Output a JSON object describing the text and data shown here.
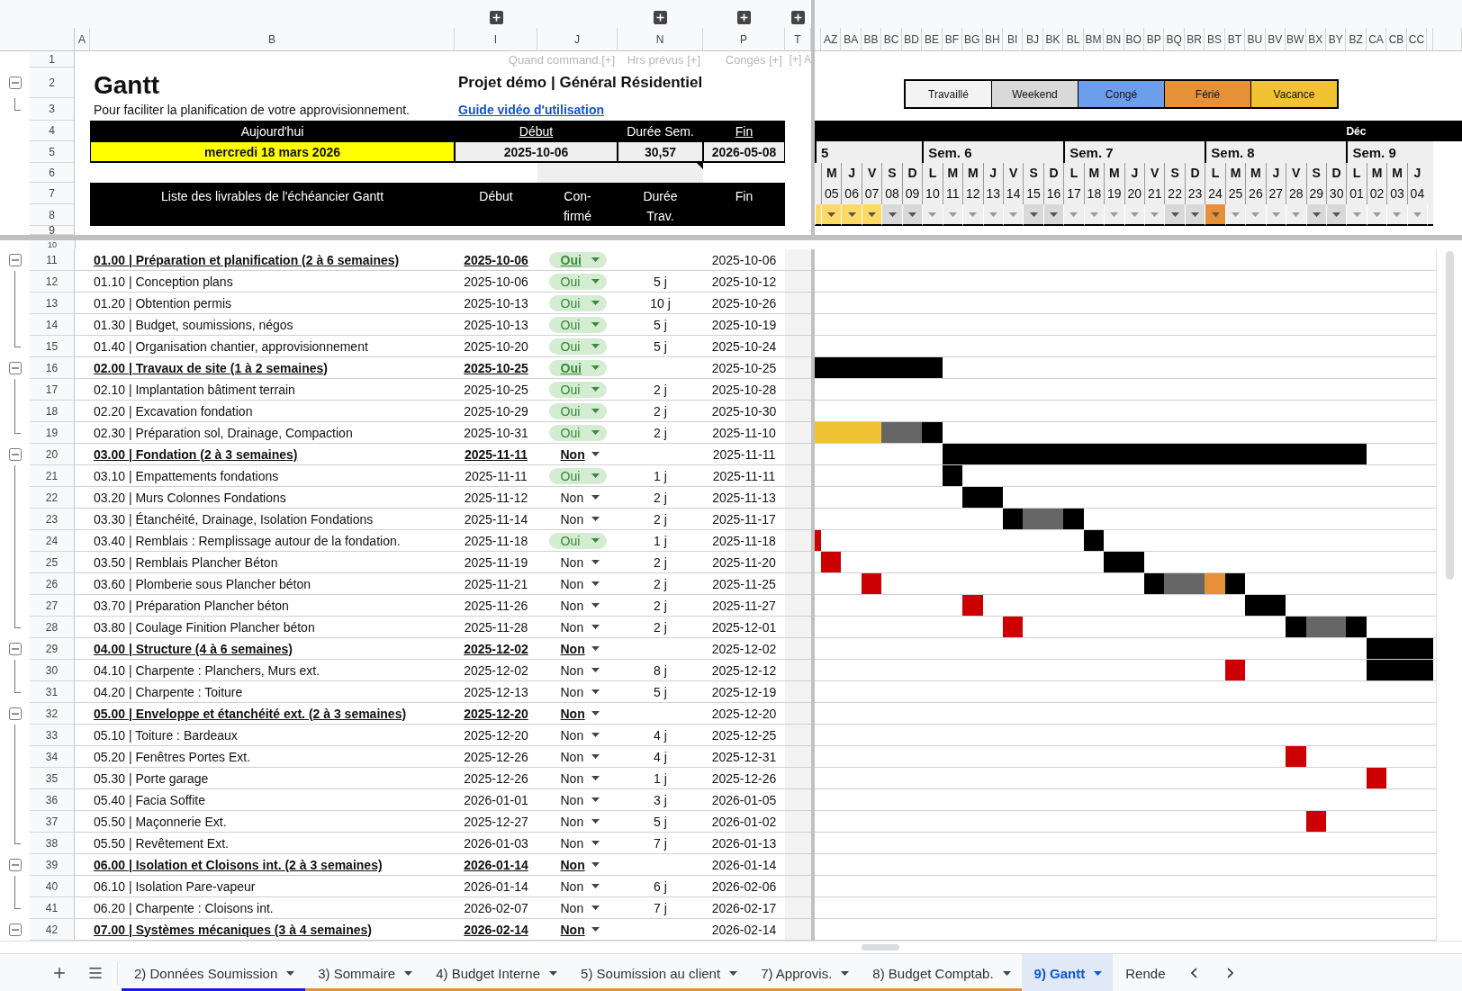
{
  "columns": [
    "A",
    "B",
    "I",
    "J",
    "N",
    "P",
    "T"
  ],
  "header_row_numbers": [
    "1",
    "2",
    "3",
    "4",
    "5",
    "6",
    "7",
    "8",
    "9"
  ],
  "row_ten": "10",
  "hints": [
    "Quand command.[+]",
    "Hrs prévus [+]",
    "Congés [+]",
    "[+] A"
  ],
  "title": "Gantt",
  "subtitle": "Pour faciliter la planification de votre approvisionnement.",
  "project": "Projet démo | Général Résidentiel",
  "guide_link": "Guide vidéo d'utilisation",
  "summary": {
    "today_label": "Aujourd'hui",
    "start_label": "Début",
    "duration_label": "Durée Sem.",
    "end_label": "Fin",
    "today": "mercredi 18 mars 2026",
    "start": "2025-10-06",
    "duration": "30,57",
    "end": "2026-05-08"
  },
  "list_header": {
    "title": "Liste des livrables de l'échéancier Gantt",
    "start": "Début",
    "confirmed": "Con-\nfirmé",
    "duration": "Durée\nTrav.",
    "end": "Fin"
  },
  "legend": [
    {
      "label": "Travaillé",
      "color": "#f3f3f3"
    },
    {
      "label": "Weekend",
      "color": "#d9d9d9"
    },
    {
      "label": "Congé",
      "color": "#6d9eeb"
    },
    {
      "label": "Férié",
      "color": "#e69138"
    },
    {
      "label": "Vacance",
      "color": "#f1c232"
    }
  ],
  "weeks": [
    {
      "label": "5",
      "days": [
        {
          "kind": "vacance",
          "partial": true
        },
        {
          "column": "AZ",
          "letter": "M",
          "number": "05",
          "kind": "vacance"
        },
        {
          "column": "BA",
          "letter": "J",
          "number": "06",
          "kind": "vacance"
        },
        {
          "column": "BB",
          "letter": "V",
          "number": "07",
          "kind": "vacance"
        },
        {
          "column": "BC",
          "letter": "S",
          "number": "08",
          "kind": "weekend"
        },
        {
          "column": "BD",
          "letter": "D",
          "number": "09",
          "kind": "weekend"
        }
      ]
    },
    {
      "label": "Sem. 6",
      "days": [
        {
          "column": "BE",
          "letter": "L",
          "number": "10",
          "kind": "work"
        },
        {
          "column": "BF",
          "letter": "M",
          "number": "11",
          "kind": "work"
        },
        {
          "column": "BG",
          "letter": "M",
          "number": "12",
          "kind": "work"
        },
        {
          "column": "BH",
          "letter": "J",
          "number": "13",
          "kind": "work"
        },
        {
          "column": "BI",
          "letter": "V",
          "number": "14",
          "kind": "work"
        },
        {
          "column": "BJ",
          "letter": "S",
          "number": "15",
          "kind": "weekend"
        },
        {
          "column": "BK",
          "letter": "D",
          "number": "16",
          "kind": "weekend"
        }
      ]
    },
    {
      "label": "Sem. 7",
      "days": [
        {
          "column": "BL",
          "letter": "L",
          "number": "17",
          "kind": "work"
        },
        {
          "column": "BM",
          "letter": "M",
          "number": "18",
          "kind": "work"
        },
        {
          "column": "BN",
          "letter": "M",
          "number": "19",
          "kind": "work"
        },
        {
          "column": "BO",
          "letter": "J",
          "number": "20",
          "kind": "work"
        },
        {
          "column": "BP",
          "letter": "V",
          "number": "21",
          "kind": "work"
        },
        {
          "column": "BQ",
          "letter": "S",
          "number": "22",
          "kind": "weekend"
        },
        {
          "column": "BR",
          "letter": "D",
          "number": "23",
          "kind": "weekend"
        }
      ]
    },
    {
      "label": "Sem. 8",
      "days": [
        {
          "column": "BS",
          "letter": "L",
          "number": "24",
          "kind": "ferie"
        },
        {
          "column": "BT",
          "letter": "M",
          "number": "25",
          "kind": "work"
        },
        {
          "column": "BU",
          "letter": "M",
          "number": "26",
          "kind": "work"
        },
        {
          "column": "BV",
          "letter": "J",
          "number": "27",
          "kind": "work"
        },
        {
          "column": "BW",
          "letter": "V",
          "number": "28",
          "kind": "work"
        },
        {
          "column": "BX",
          "letter": "S",
          "number": "29",
          "kind": "weekend"
        },
        {
          "column": "BY",
          "letter": "D",
          "number": "30",
          "kind": "weekend"
        }
      ]
    },
    {
      "label": "Sem. 9",
      "days": [
        {
          "column": "BZ",
          "letter": "L",
          "number": "01",
          "kind": "work",
          "month": "Déc"
        },
        {
          "column": "CA",
          "letter": "M",
          "number": "02",
          "kind": "work"
        },
        {
          "column": "CB",
          "letter": "M",
          "number": "03",
          "kind": "work"
        },
        {
          "column": "CC",
          "letter": "J",
          "number": "04",
          "kind": "work"
        },
        {
          "kind": "work",
          "partial": true
        }
      ]
    }
  ],
  "rows": [
    {
      "number": "11",
      "section": true,
      "name": "01.00 | Préparation et planification (2 à 6 semaines)",
      "start": "2025-10-06",
      "confirmed": true,
      "confirmed_label": "Oui",
      "end": "2025-10-06"
    },
    {
      "number": "12",
      "section": false,
      "name": "01.10 | Conception plans",
      "start": "2025-10-06",
      "confirmed": true,
      "confirmed_label": "Oui",
      "duration": "5 j",
      "end": "2025-10-12"
    },
    {
      "number": "13",
      "section": false,
      "name": "01.20 | Obtention permis",
      "start": "2025-10-13",
      "confirmed": true,
      "confirmed_label": "Oui",
      "duration": "10 j",
      "end": "2025-10-26"
    },
    {
      "number": "14",
      "section": false,
      "name": "01.30 | Budget, soumissions, négos",
      "start": "2025-10-13",
      "confirmed": true,
      "confirmed_label": "Oui",
      "duration": "5 j",
      "end": "2025-10-19"
    },
    {
      "number": "15",
      "section": false,
      "name": "01.40 | Organisation chantier, approvisionnement",
      "start": "2025-10-20",
      "confirmed": true,
      "confirmed_label": "Oui",
      "duration": "5 j",
      "end": "2025-10-24"
    },
    {
      "number": "16",
      "section": true,
      "name": "02.00 | Travaux de site (1 à 2 semaines)",
      "start": "2025-10-25",
      "confirmed": true,
      "confirmed_label": "Oui",
      "end": "2025-10-25"
    },
    {
      "number": "17",
      "section": false,
      "name": "02.10 | Implantation bâtiment terrain",
      "start": "2025-10-25",
      "confirmed": true,
      "confirmed_label": "Oui",
      "duration": "2 j",
      "end": "2025-10-28"
    },
    {
      "number": "18",
      "section": false,
      "name": "02.20 | Excavation fondation",
      "start": "2025-10-29",
      "confirmed": true,
      "confirmed_label": "Oui",
      "duration": "2 j",
      "end": "2025-10-30"
    },
    {
      "number": "19",
      "section": false,
      "name": "02.30 | Préparation sol, Drainage, Compaction",
      "start": "2025-10-31",
      "confirmed": true,
      "confirmed_label": "Oui",
      "duration": "2 j",
      "end": "2025-11-10"
    },
    {
      "number": "20",
      "section": true,
      "name": "03.00 | Fondation (2 à 3 semaines)",
      "start": "2025-11-11",
      "confirmed": false,
      "confirmed_label": "Non",
      "end": "2025-11-11"
    },
    {
      "number": "21",
      "section": false,
      "name": "03.10 | Empattements fondations",
      "start": "2025-11-11",
      "confirmed": true,
      "confirmed_label": "Oui",
      "duration": "1 j",
      "end": "2025-11-11"
    },
    {
      "number": "22",
      "section": false,
      "name": "03.20 | Murs Colonnes Fondations",
      "start": "2025-11-12",
      "confirmed": false,
      "confirmed_label": "Non",
      "duration": "2 j",
      "end": "2025-11-13"
    },
    {
      "number": "23",
      "section": false,
      "name": "03.30 | Étanchéité, Drainage, Isolation Fondations",
      "start": "2025-11-14",
      "confirmed": false,
      "confirmed_label": "Non",
      "duration": "2 j",
      "end": "2025-11-17"
    },
    {
      "number": "24",
      "section": false,
      "name": "03.40 | Remblais : Remplissage autour de la fondation.",
      "start": "2025-11-18",
      "confirmed": true,
      "confirmed_label": "Oui",
      "duration": "1 j",
      "end": "2025-11-18"
    },
    {
      "number": "25",
      "section": false,
      "name": "03.50 | Remblais Plancher Béton",
      "start": "2025-11-19",
      "confirmed": false,
      "confirmed_label": "Non",
      "duration": "2 j",
      "end": "2025-11-20"
    },
    {
      "number": "26",
      "section": false,
      "name": "03.60 | Plomberie sous Plancher béton",
      "start": "2025-11-21",
      "confirmed": false,
      "confirmed_label": "Non",
      "duration": "2 j",
      "end": "2025-11-25"
    },
    {
      "number": "27",
      "section": false,
      "name": "03.70 | Préparation Plancher béton",
      "start": "2025-11-26",
      "confirmed": false,
      "confirmed_label": "Non",
      "duration": "2 j",
      "end": "2025-11-27"
    },
    {
      "number": "28",
      "section": false,
      "name": "03.80 | Coulage Finition Plancher béton",
      "start": "2025-11-28",
      "confirmed": false,
      "confirmed_label": "Non",
      "duration": "2 j",
      "end": "2025-12-01"
    },
    {
      "number": "29",
      "section": true,
      "name": "04.00 | Structure (4 à 6 semaines)",
      "start": "2025-12-02",
      "confirmed": false,
      "confirmed_label": "Non",
      "end": "2025-12-02"
    },
    {
      "number": "30",
      "section": false,
      "name": "04.10 | Charpente : Planchers, Murs ext.",
      "start": "2025-12-02",
      "confirmed": false,
      "confirmed_label": "Non",
      "duration": "8 j",
      "end": "2025-12-12"
    },
    {
      "number": "31",
      "section": false,
      "name": "04.20 | Charpente : Toiture",
      "start": "2025-12-13",
      "confirmed": false,
      "confirmed_label": "Non",
      "duration": "5 j",
      "end": "2025-12-19"
    },
    {
      "number": "32",
      "section": true,
      "name": "05.00 | Enveloppe et étanchéité ext. (2 à 3 semaines)",
      "start": "2025-12-20",
      "confirmed": false,
      "confirmed_label": "Non",
      "end": "2025-12-20"
    },
    {
      "number": "33",
      "section": false,
      "name": "05.10 | Toiture : Bardeaux",
      "start": "2025-12-20",
      "confirmed": false,
      "confirmed_label": "Non",
      "duration": "4 j",
      "end": "2025-12-25"
    },
    {
      "number": "34",
      "section": false,
      "name": "05.20 | Fenêtres Portes Ext.",
      "start": "2025-12-26",
      "confirmed": false,
      "confirmed_label": "Non",
      "duration": "4 j",
      "end": "2025-12-31"
    },
    {
      "number": "35",
      "section": false,
      "name": "05.30 | Porte garage",
      "start": "2025-12-26",
      "confirmed": false,
      "confirmed_label": "Non",
      "duration": "1 j",
      "end": "2025-12-26"
    },
    {
      "number": "36",
      "section": false,
      "name": "05.40 | Facia Soffite",
      "start": "2026-01-01",
      "confirmed": false,
      "confirmed_label": "Non",
      "duration": "3 j",
      "end": "2026-01-05"
    },
    {
      "number": "37",
      "section": false,
      "name": "05.50 | Maçonnerie Ext.",
      "start": "2025-12-27",
      "confirmed": false,
      "confirmed_label": "Non",
      "duration": "5 j",
      "end": "2026-01-02"
    },
    {
      "number": "38",
      "section": false,
      "name": "05.50 | Revêtement Ext.",
      "start": "2026-01-03",
      "confirmed": false,
      "confirmed_label": "Non",
      "duration": "7 j",
      "end": "2026-01-13"
    },
    {
      "number": "39",
      "section": true,
      "name": "06.00 | Isolation et Cloisons int. (2 à 3 semaines)",
      "start": "2026-01-14",
      "confirmed": false,
      "confirmed_label": "Non",
      "end": "2026-01-14"
    },
    {
      "number": "40",
      "section": false,
      "name": "06.10 | Isolation Pare-vapeur",
      "start": "2026-01-14",
      "confirmed": false,
      "confirmed_label": "Non",
      "duration": "6 j",
      "end": "2026-02-06"
    },
    {
      "number": "41",
      "section": false,
      "name": "06.20 | Charpente : Cloisons int.",
      "start": "2026-02-07",
      "confirmed": false,
      "confirmed_label": "Non",
      "duration": "7 j",
      "end": "2026-02-17"
    },
    {
      "number": "42",
      "section": true,
      "name": "07.00 | Systèmes mécaniques (3 à 4 semaines)",
      "start": "2026-02-14",
      "confirmed": false,
      "confirmed_label": "Non",
      "end": "2026-02-14"
    }
  ],
  "sheet_tabs": [
    {
      "label": "2) Données Soumission",
      "color": "#1a1ae6",
      "selected": false
    },
    {
      "label": "3) Sommaire",
      "color": "#e69138",
      "selected": false
    },
    {
      "label": "4) Budget Interne",
      "color": "#e69138",
      "selected": false
    },
    {
      "label": "5) Soumission au client",
      "color": "#e69138",
      "selected": false
    },
    {
      "label": "7) Approvis.",
      "color": "#e69138",
      "selected": false
    },
    {
      "label": "8) Budget Comptab.",
      "color": "#e69138",
      "selected": false
    },
    {
      "label": "9) Gantt",
      "selected": true
    },
    {
      "label": "Rende",
      "selected": false
    }
  ]
}
